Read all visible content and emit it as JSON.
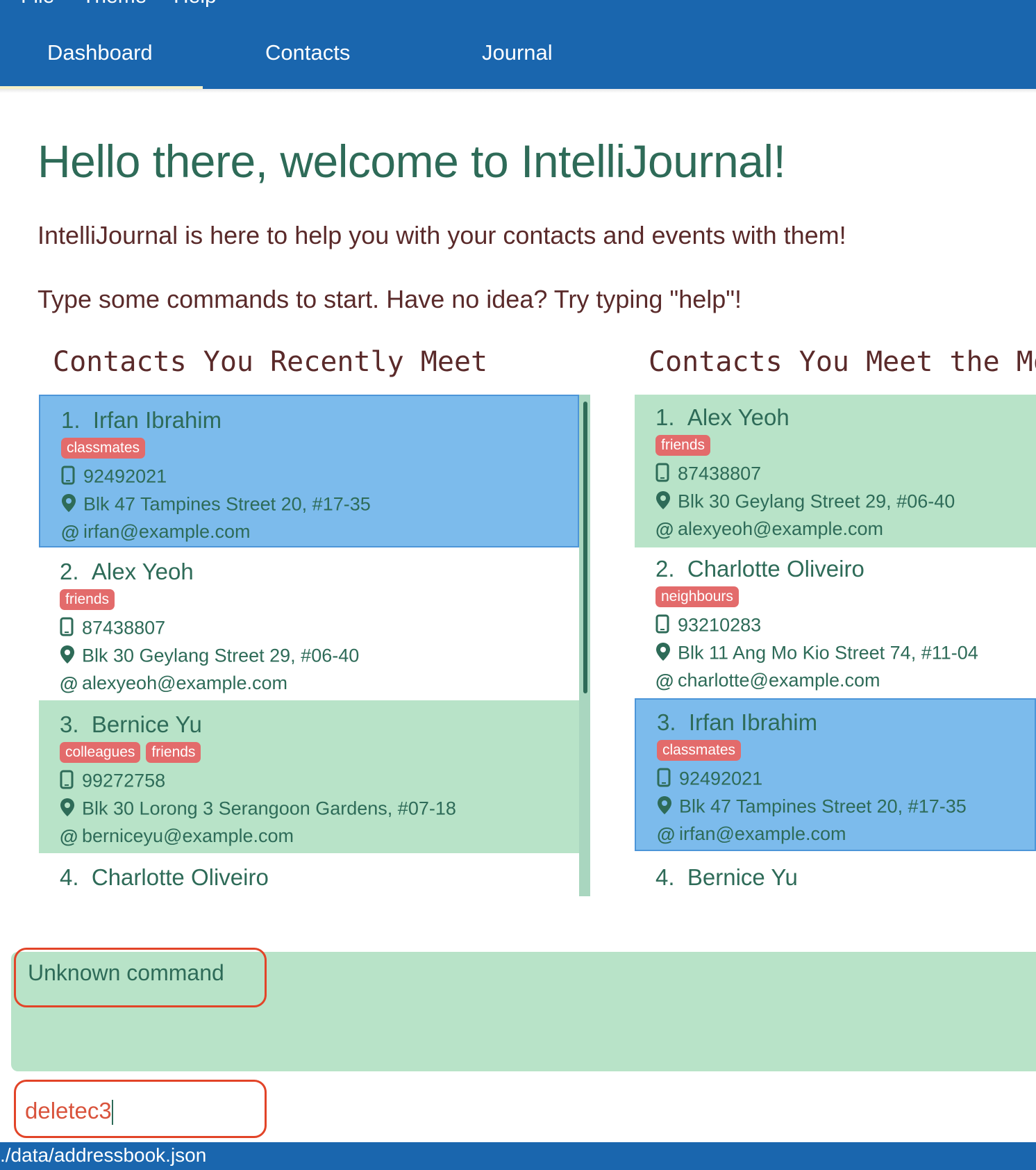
{
  "menu": [
    "File",
    "Theme",
    "Help"
  ],
  "tabs": [
    "Dashboard",
    "Contacts",
    "Journal"
  ],
  "welcome": {
    "title": "Hello there, welcome to IntelliJournal!",
    "line1": "IntelliJournal is here to help you with your contacts and events with them!",
    "line2": "Type some commands to start. Have no idea? Try typing \"help\"!"
  },
  "recent": {
    "heading": "Contacts You Recently Meet",
    "items": [
      {
        "index": "1.",
        "name": "Irfan Ibrahim",
        "tags": [
          "classmates"
        ],
        "phone": "92492021",
        "address": "Blk 47 Tampines Street 20, #17-35",
        "email": "irfan@example.com"
      },
      {
        "index": "2.",
        "name": "Alex Yeoh",
        "tags": [
          "friends"
        ],
        "phone": "87438807",
        "address": "Blk 30 Geylang Street 29, #06-40",
        "email": "alexyeoh@example.com"
      },
      {
        "index": "3.",
        "name": "Bernice Yu",
        "tags": [
          "colleagues",
          "friends"
        ],
        "phone": "99272758",
        "address": "Blk 30 Lorong 3 Serangoon Gardens, #07-18",
        "email": "berniceyu@example.com"
      },
      {
        "index": "4.",
        "name": "Charlotte Oliveiro"
      }
    ]
  },
  "most": {
    "heading": "Contacts You Meet the Most",
    "items": [
      {
        "index": "1.",
        "name": "Alex Yeoh",
        "tags": [
          "friends"
        ],
        "phone": "87438807",
        "address": "Blk 30 Geylang Street 29, #06-40",
        "email": "alexyeoh@example.com"
      },
      {
        "index": "2.",
        "name": "Charlotte Oliveiro",
        "tags": [
          "neighbours"
        ],
        "phone": "93210283",
        "address": "Blk 11 Ang Mo Kio Street 74, #11-04",
        "email": "charlotte@example.com"
      },
      {
        "index": "3.",
        "name": "Irfan Ibrahim",
        "tags": [
          "classmates"
        ],
        "phone": "92492021",
        "address": "Blk 47 Tampines Street 20, #17-35",
        "email": "irfan@example.com"
      },
      {
        "index": "4.",
        "name": "Bernice Yu"
      }
    ]
  },
  "result": {
    "text": "Unknown command"
  },
  "command": {
    "value": "deletec3"
  },
  "status": {
    "path": "./data/addressbook.json"
  },
  "colors": {
    "primary": "#1a66ae",
    "selected": "#7cbbec",
    "alt_row": "#b8e3c8",
    "tag": "#e36b6b",
    "text": "#2e6b58",
    "highlight": "#e24428"
  },
  "icons": {
    "phone": "phone-icon",
    "address": "location-pin-icon",
    "email": "at-sign-icon"
  }
}
